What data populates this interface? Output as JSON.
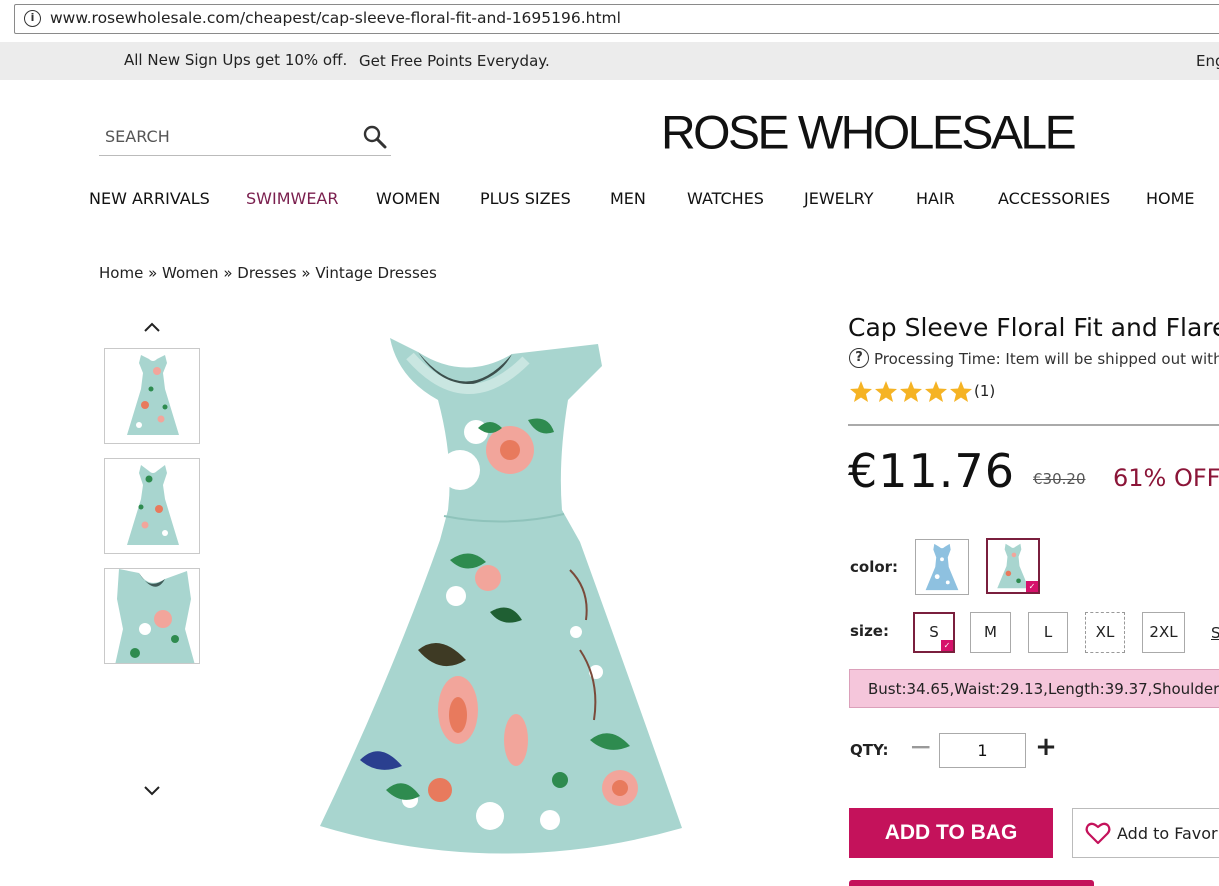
{
  "browser": {
    "url": "www.rosewholesale.com/cheapest/cap-sleeve-floral-fit-and-1695196.html",
    "info_icon": "info-icon"
  },
  "promo": {
    "text1": "All New Sign Ups get 10% off.",
    "text2": "Get Free Points Everyday.",
    "language": "Eng"
  },
  "header": {
    "search_placeholder": "SEARCH",
    "search_icon": "search-icon",
    "logo": "ROSE WHOLESALE"
  },
  "nav": {
    "items": [
      {
        "label": "NEW ARRIVALS"
      },
      {
        "label": "SWIMWEAR",
        "accent": "#7a1f4e"
      },
      {
        "label": "WOMEN"
      },
      {
        "label": "PLUS SIZES"
      },
      {
        "label": "MEN"
      },
      {
        "label": "WATCHES"
      },
      {
        "label": "JEWELRY"
      },
      {
        "label": "HAIR"
      },
      {
        "label": "ACCESSORIES"
      },
      {
        "label": "HOME"
      }
    ]
  },
  "breadcrumb": {
    "items": [
      "Home",
      "Women",
      "Dresses",
      "Vintage Dresses"
    ],
    "separator": "»"
  },
  "gallery": {
    "up_icon": "chevron-up-icon",
    "down_icon": "chevron-down-icon",
    "thumbnails": 3
  },
  "product": {
    "title": "Cap Sleeve Floral Fit and Flare",
    "processing": "Processing Time: Item will be shipped out with",
    "rating_stars": 5,
    "review_count": "(1)",
    "price": "€11.76",
    "old_price": "€30.20",
    "discount": "61% OFF",
    "color_label": "color:",
    "size_label": "size:",
    "sizes": [
      "S",
      "M",
      "L",
      "XL",
      "2XL"
    ],
    "selected_size": "S",
    "unavailable_size": "XL",
    "size_guide": "S",
    "measurements": "Bust:34.65,Waist:29.13,Length:39.37,Shoulder",
    "qty_label": "QTY:",
    "qty_value": "1",
    "qty_minus": "−",
    "qty_plus": "+",
    "add_to_bag": "ADD TO BAG",
    "add_to_favorites": "Add to Favorites"
  },
  "colors": {
    "accent": "#c4125b",
    "discount": "#8b1538",
    "dress": "#a8d5cf",
    "star": "#f5b324",
    "measure_bg": "#f5c6db"
  }
}
